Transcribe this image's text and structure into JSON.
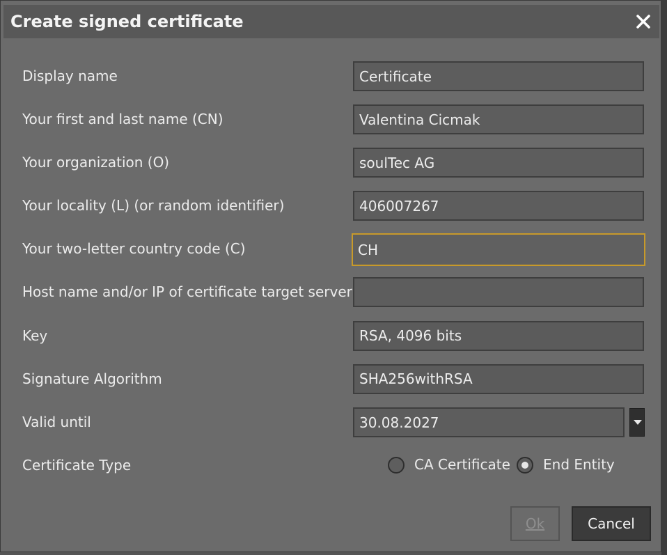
{
  "dialog": {
    "title": "Create signed certificate",
    "close_icon": "close-icon"
  },
  "form": {
    "display_name": {
      "label": "Display name",
      "value": "Certificate"
    },
    "common_name": {
      "label": "Your first and last name (CN)",
      "value": "Valentina Cicmak"
    },
    "organization": {
      "label": "Your organization (O)",
      "value": "soulTec AG"
    },
    "locality": {
      "label": "Your locality (L) (or random identifier)",
      "value": "406007267"
    },
    "country": {
      "label": "Your two-letter country code (C)",
      "value": "CH"
    },
    "host": {
      "label": "Host name and/or IP of certificate target server",
      "value": ""
    },
    "key": {
      "label": "Key",
      "value": "RSA, 4096 bits"
    },
    "signature": {
      "label": "Signature Algorithm",
      "value": "SHA256withRSA"
    },
    "valid_until": {
      "label": "Valid until",
      "value": "30.08.2027",
      "dropdown_icon": "chevron-down-icon"
    },
    "cert_type": {
      "label": "Certificate Type",
      "options": [
        "CA Certificate",
        "End Entity"
      ],
      "selected": "End Entity"
    }
  },
  "buttons": {
    "ok": "Ok",
    "cancel": "Cancel"
  },
  "colors": {
    "dialog_bg": "#6b6b6b",
    "titlebar_bg": "#585858",
    "focus_border": "#c89a2a",
    "field_bg": "#5d5d5d"
  }
}
